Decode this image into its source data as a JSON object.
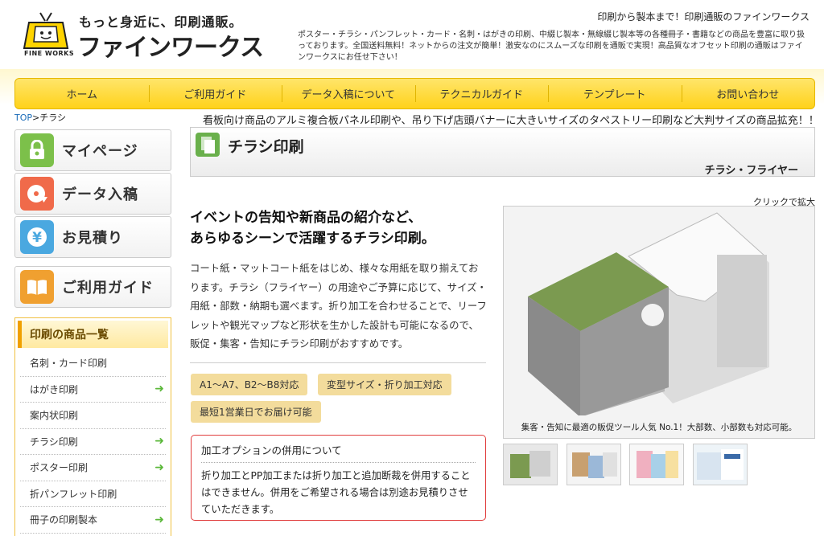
{
  "header": {
    "tagline": "もっと身近に、印刷通販。",
    "brand_name": "ファインワークス",
    "logo_text": "FINE WORKS",
    "right_title": "印刷から製本まで！印刷通販のファインワークス",
    "description": "ポスター・チラシ・パンフレット・カード・名刺・はがきの印刷、中綴じ製本・無線綴じ製本等の各種冊子・書籍などの商品を豊富に取り扱っております。全国送料無料！ネットからの注文が簡単！激安なのにスムーズな印刷を通販で実現！高品質なオフセット印刷の通販はファインワークスにお任せ下さい！"
  },
  "nav": [
    {
      "label": "ホーム"
    },
    {
      "label": "ご利用ガイド"
    },
    {
      "label": "データ入稿について"
    },
    {
      "label": "テクニカルガイド"
    },
    {
      "label": "テンプレート"
    },
    {
      "label": "お問い合わせ"
    }
  ],
  "breadcrumb": {
    "top": "TOP",
    "separator": ">",
    "current": "チラシ"
  },
  "ticker": "看板向け商品のアルミ複合板パネル印刷や、吊り下げ店頭バナーに大きいサイズのタペストリー印刷など大判サイズの商品拡充！！",
  "sidebar": {
    "buttons": [
      {
        "label": "マイページ",
        "icon": "lock-icon",
        "color": "#7cc04a"
      },
      {
        "label": "データ入稿",
        "icon": "disc-icon",
        "color": "#f06a4a"
      },
      {
        "label": "お見積り",
        "icon": "yen-icon",
        "color": "#4aa8e0"
      },
      {
        "label": "ご利用ガイド",
        "icon": "book-icon",
        "color": "#f0a030"
      }
    ],
    "products_heading": "印刷の商品一覧",
    "products": [
      {
        "label": "名刺・カード印刷",
        "arrow": false
      },
      {
        "label": "はがき印刷",
        "arrow": true
      },
      {
        "label": "案内状印刷",
        "arrow": false
      },
      {
        "label": "チラシ印刷",
        "arrow": true
      },
      {
        "label": "ポスター印刷",
        "arrow": true
      },
      {
        "label": "折パンフレット印刷",
        "arrow": false
      },
      {
        "label": "冊子の印刷製本",
        "arrow": true
      }
    ]
  },
  "main": {
    "title": "チラシ印刷",
    "subtitle": "チラシ・フライヤー",
    "lead_1": "イベントの告知や新商品の紹介など、",
    "lead_2": "あらゆるシーンで活躍するチラシ印刷。",
    "body": "コート紙・マットコート紙をはじめ、様々な用紙を取り揃えております。チラシ（フライヤー）の用途やご予算に応じて、サイズ・用紙・部数・納期も選べます。折り加工を合わせることで、リーフレットや観光マップなど形状を生かした設計も可能になるので、販促・集客・告知にチラシ印刷がおすすめです。",
    "tags": [
      "A1〜A7、B2〜B8対応",
      "変型サイズ・折り加工対応",
      "最短1営業日でお届け可能"
    ],
    "notice_title": "加工オプションの併用について",
    "notice_body": "折り加工とPP加工または折り加工と追加断裁を併用することはできません。併用をご希望される場合は別途お見積りさせていただきます。",
    "zoom_hint": "クリックで拡大",
    "image_caption": "集客・告知に最適の販促ツール人気 No.1！大部数、小部数も対応可能。"
  }
}
